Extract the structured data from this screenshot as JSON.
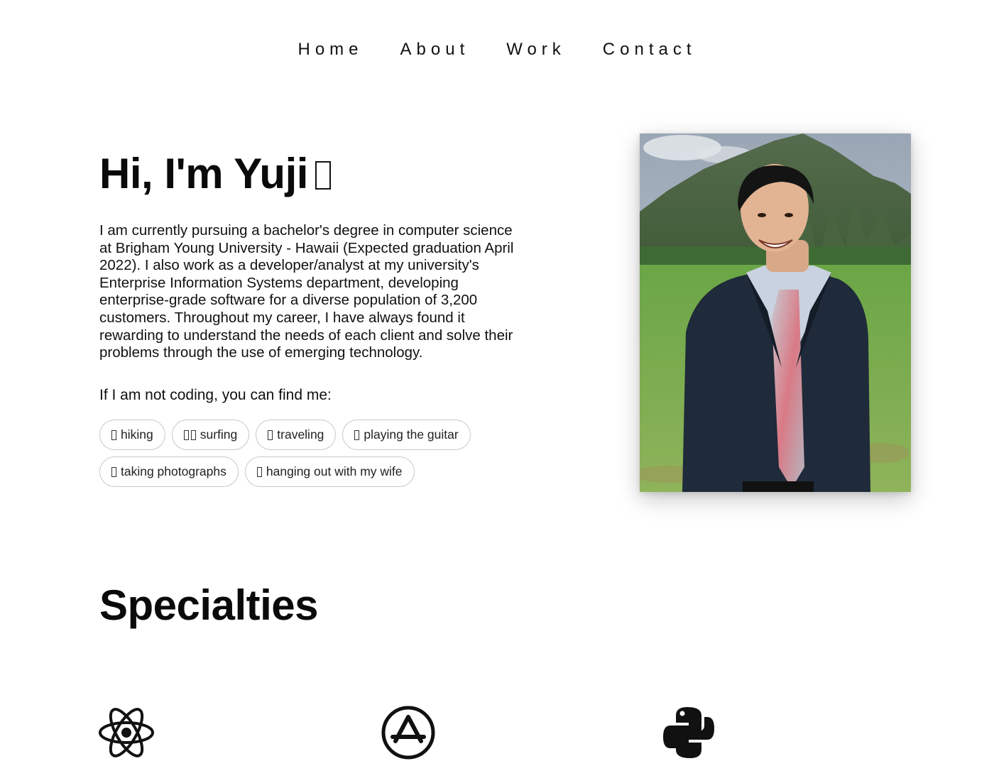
{
  "nav": {
    "items": [
      {
        "label": "Home"
      },
      {
        "label": "About"
      },
      {
        "label": "Work"
      },
      {
        "label": "Contact"
      }
    ]
  },
  "hero": {
    "title": "Hi, I'm Yuji",
    "title_emoji_icon": "waving-hand-icon",
    "bio": "I am currently pursuing a bachelor's degree in computer science at Brigham Young University - Hawaii (Expected graduation April 2022). I also work as a developer/analyst at my university's Enterprise Information Systems department, developing enterprise-grade software for a diverse population of 3,200 customers. Throughout my career, I have always found it rewarding to understand the needs of each client and solve their problems through the use of emerging technology.",
    "find_me": "If I am not coding, you can find me:",
    "hobbies": [
      {
        "label": "hiking",
        "icon": "hiking-icon"
      },
      {
        "label": "surfing",
        "icon": "surfing-icon"
      },
      {
        "label": "traveling",
        "icon": "airplane-icon"
      },
      {
        "label": "playing the guitar",
        "icon": "guitar-icon"
      },
      {
        "label": "taking photographs",
        "icon": "camera-icon"
      },
      {
        "label": "hanging out with my wife",
        "icon": "couple-icon"
      }
    ],
    "photo_icon": "profile-photo"
  },
  "specialties": {
    "title": "Specialties",
    "items": [
      {
        "icon": "react-icon"
      },
      {
        "icon": "app-store-icon"
      },
      {
        "icon": "python-icon"
      }
    ]
  }
}
